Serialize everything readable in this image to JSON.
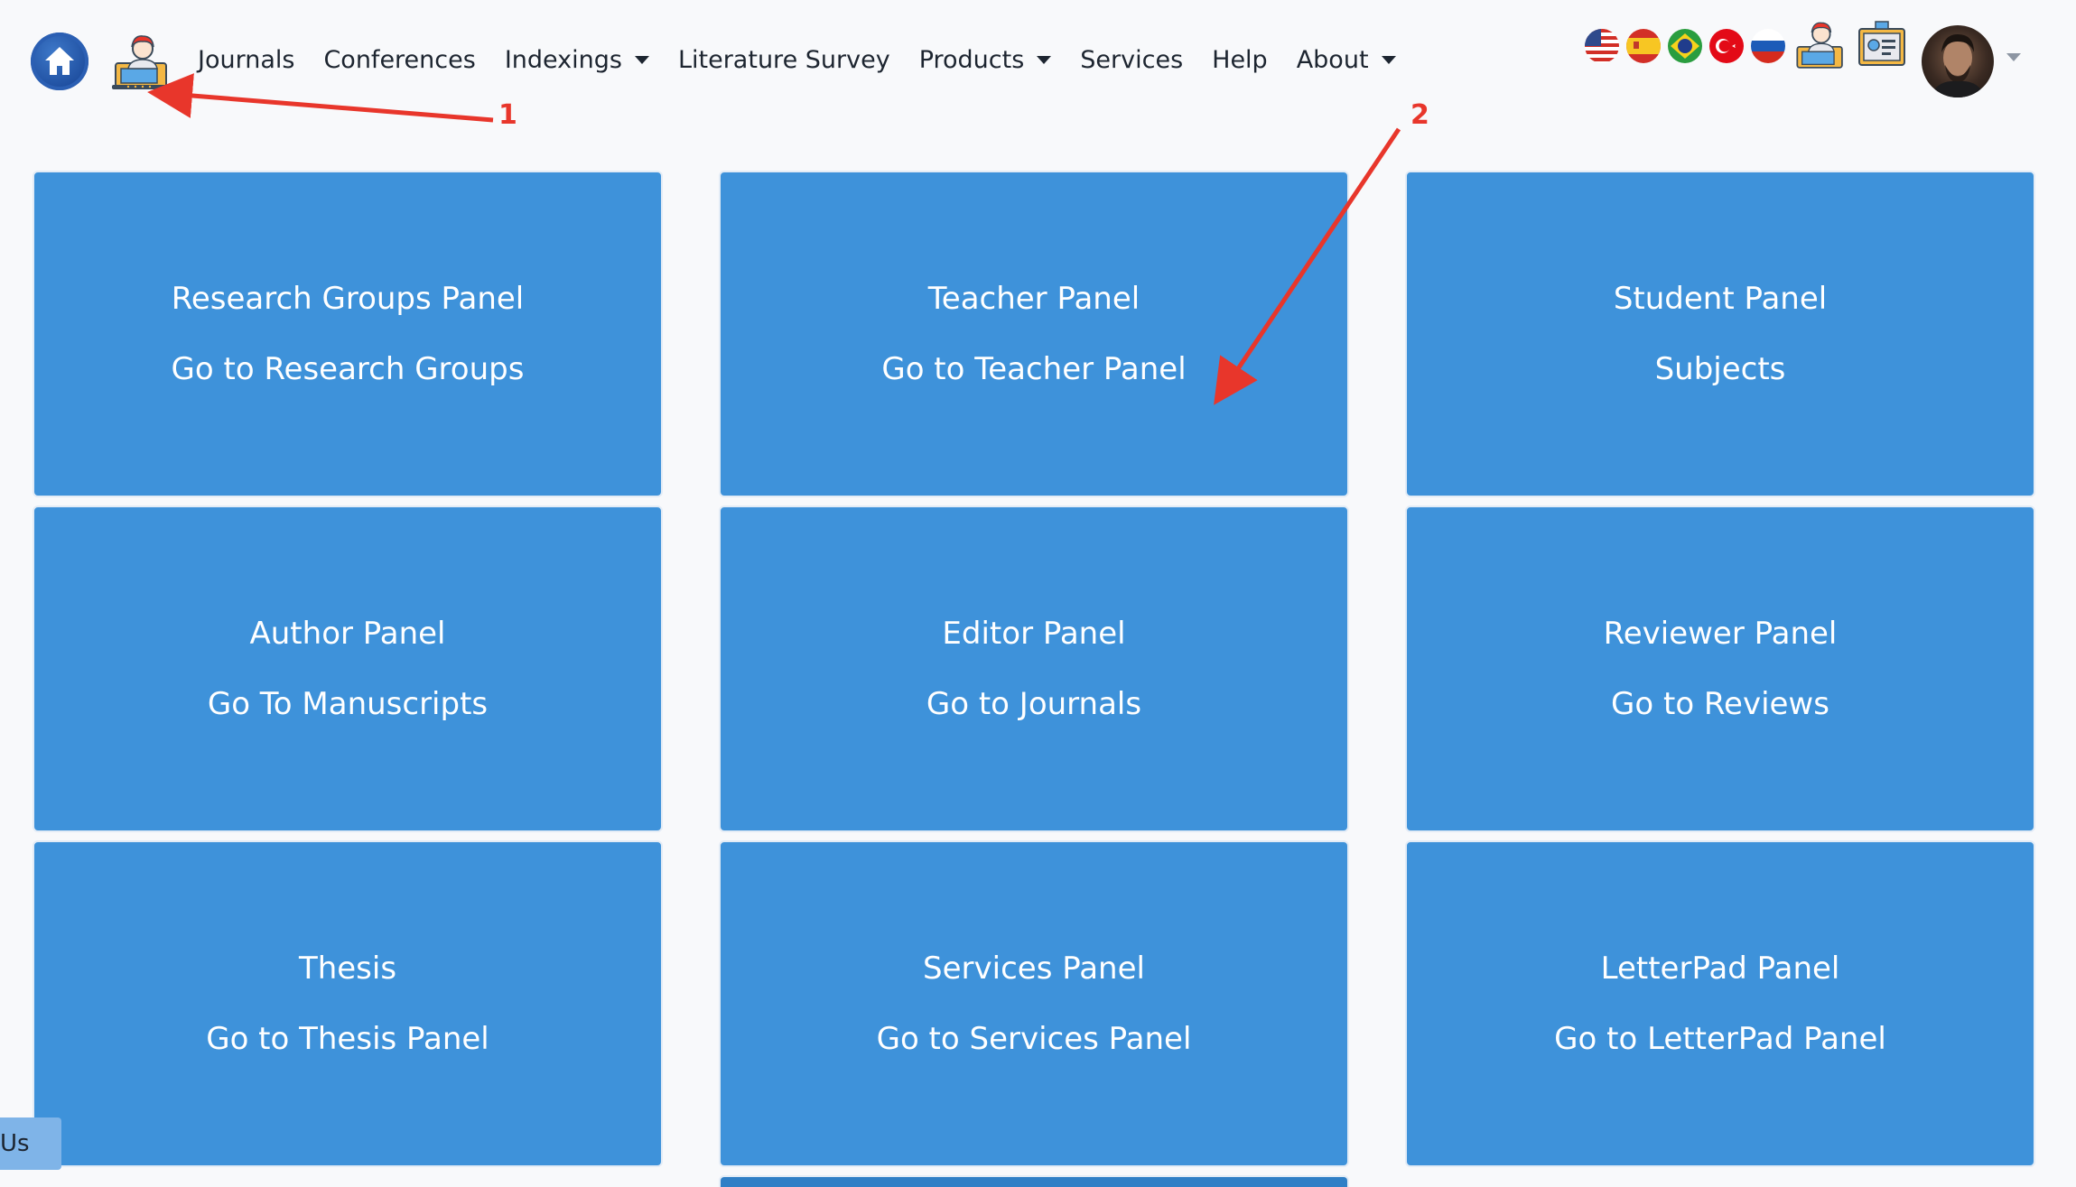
{
  "nav": {
    "links": [
      {
        "label": "Journals",
        "dropdown": false
      },
      {
        "label": "Conferences",
        "dropdown": false
      },
      {
        "label": "Indexings",
        "dropdown": true
      },
      {
        "label": "Literature Survey",
        "dropdown": false
      },
      {
        "label": "Products",
        "dropdown": true
      },
      {
        "label": "Services",
        "dropdown": false
      },
      {
        "label": "Help",
        "dropdown": false
      },
      {
        "label": "About",
        "dropdown": true
      }
    ],
    "flags": [
      "us-flag-icon",
      "spain-flag-icon",
      "brazil-flag-icon",
      "turkey-flag-icon",
      "russia-flag-icon"
    ]
  },
  "cards": [
    {
      "title": "Research Groups Panel",
      "link": "Go to Research Groups"
    },
    {
      "title": "Teacher Panel",
      "link": "Go to Teacher Panel"
    },
    {
      "title": "Student Panel",
      "link": "Subjects"
    },
    {
      "title": "Author Panel",
      "link": "Go To Manuscripts"
    },
    {
      "title": "Editor Panel",
      "link": "Go to Journals"
    },
    {
      "title": "Reviewer Panel",
      "link": "Go to Reviews"
    },
    {
      "title": "Thesis",
      "link": "Go to Thesis Panel"
    },
    {
      "title": "Services Panel",
      "link": "Go to Services Panel"
    },
    {
      "title": "LetterPad Panel",
      "link": "Go to LetterPad Panel"
    }
  ],
  "contact_tab": "Us",
  "annotations": {
    "first": "1",
    "second": "2",
    "color": "#e8362b"
  },
  "colors": {
    "card": "#3e92da",
    "background": "#f8f9fb"
  }
}
